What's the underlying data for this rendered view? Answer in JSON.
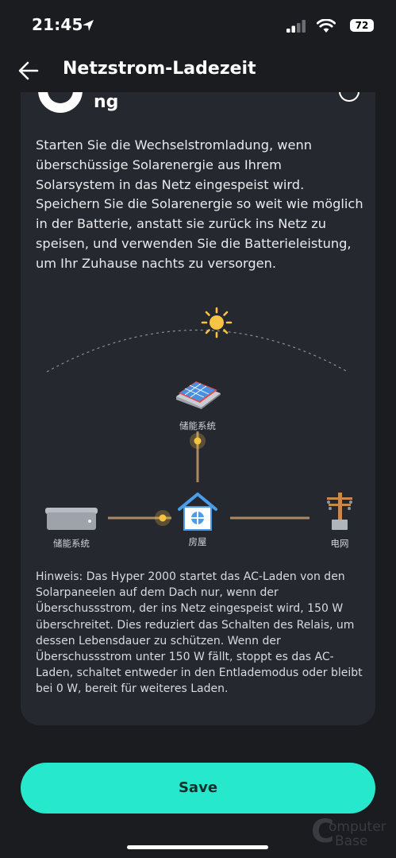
{
  "status_bar": {
    "time": "21:45",
    "battery": "72"
  },
  "header": {
    "title": "Netzstrom-Ladezeit"
  },
  "card": {
    "title_fragment": "ng",
    "description": "Starten Sie die Wechselstromladung, wenn überschüssige Solarenergie aus Ihrem Solarsystem in das Netz eingespeist wird. Speichern Sie die Solarenergie so weit wie möglich in der Batterie, anstatt sie zurück ins Netz zu speisen, und verwenden Sie die Batterieleistung, um Ihr Zuhause nachts zu versorgen.",
    "diagram": {
      "label_panel": "储能系统",
      "label_battery": "储能系统",
      "label_house": "房屋",
      "label_grid": "电网"
    },
    "hint": "Hinweis: Das Hyper 2000 startet das AC-Laden von den Solarpaneelen auf dem Dach nur, wenn der Überschussstrom, der ins Netz eingespeist wird, 150 W überschreitet. Dies reduziert das Schalten des Relais, um dessen Lebensdauer zu schützen. Wenn der Überschussstrom unter 150 W fällt, stoppt es das AC-Laden, schaltet entweder in den Entlademodus oder bleibt bei 0 W, bereit für weiteres Laden."
  },
  "save_label": "Save",
  "colors": {
    "background": "#1b1c20",
    "card": "#26282f",
    "accent": "#25e8cc",
    "sun": "#f6c343",
    "line": "#a88a63"
  },
  "icons": [
    "location-arrow-icon",
    "signal-icon",
    "wifi-icon",
    "battery-icon",
    "back-arrow-icon",
    "sun-icon",
    "solar-panel-icon",
    "battery-unit-icon",
    "house-icon",
    "power-pylon-icon"
  ]
}
